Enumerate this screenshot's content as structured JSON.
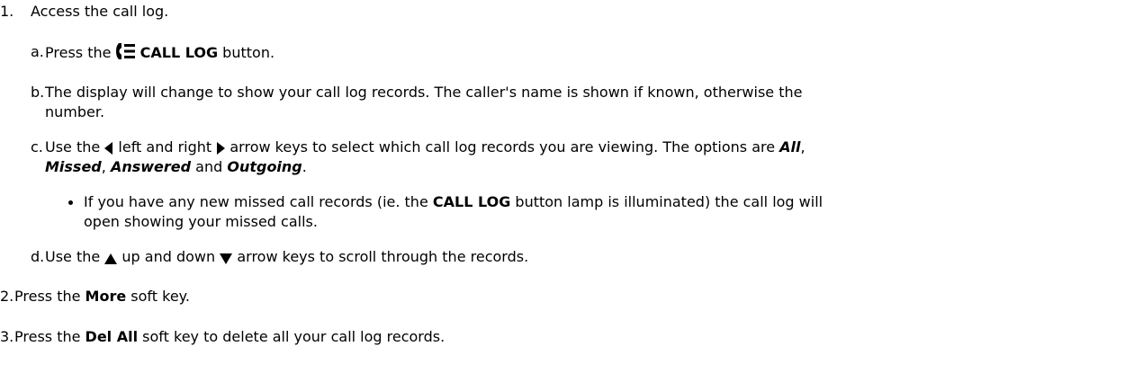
{
  "steps": [
    {
      "num": "1.",
      "text": "Access the call log."
    },
    {
      "num": "2.",
      "pre": "Press the ",
      "bold": "More",
      "post": " soft key."
    },
    {
      "num": "3.",
      "pre": "Press the ",
      "bold": "Del All",
      "post": " soft key to delete all your call log records."
    }
  ],
  "substeps": {
    "a": {
      "num": "a.",
      "pre": "Press the ",
      "bold": "CALL LOG",
      "post": " button."
    },
    "b": {
      "num": "b.",
      "line1": "The display will change to show your call log records. The caller's name is shown if known, otherwise the",
      "line2": "number."
    },
    "c": {
      "num": "c.",
      "t1": "Use the ",
      "t2": " left and right ",
      "t3": " arrow keys to select which call log records you are viewing. The options are ",
      "opt_all": "All",
      "t4": ",",
      "opt_missed": "Missed",
      "t5": ", ",
      "opt_answered": "Answered",
      "t6": " and ",
      "opt_outgoing": "Outgoing",
      "t7": "."
    },
    "bullet": {
      "t1": "If you have any new missed call records (ie. the ",
      "bold": "CALL LOG",
      "t2": " button lamp is illuminated) the call log will",
      "line2": "open showing your missed calls."
    },
    "d": {
      "num": "d.",
      "t1": "Use the ",
      "t2": " up and down ",
      "t3": " arrow keys to scroll through the records."
    }
  },
  "icons": [
    "call-log-icon",
    "left-arrow-icon",
    "right-arrow-icon",
    "up-arrow-icon",
    "down-arrow-icon"
  ]
}
